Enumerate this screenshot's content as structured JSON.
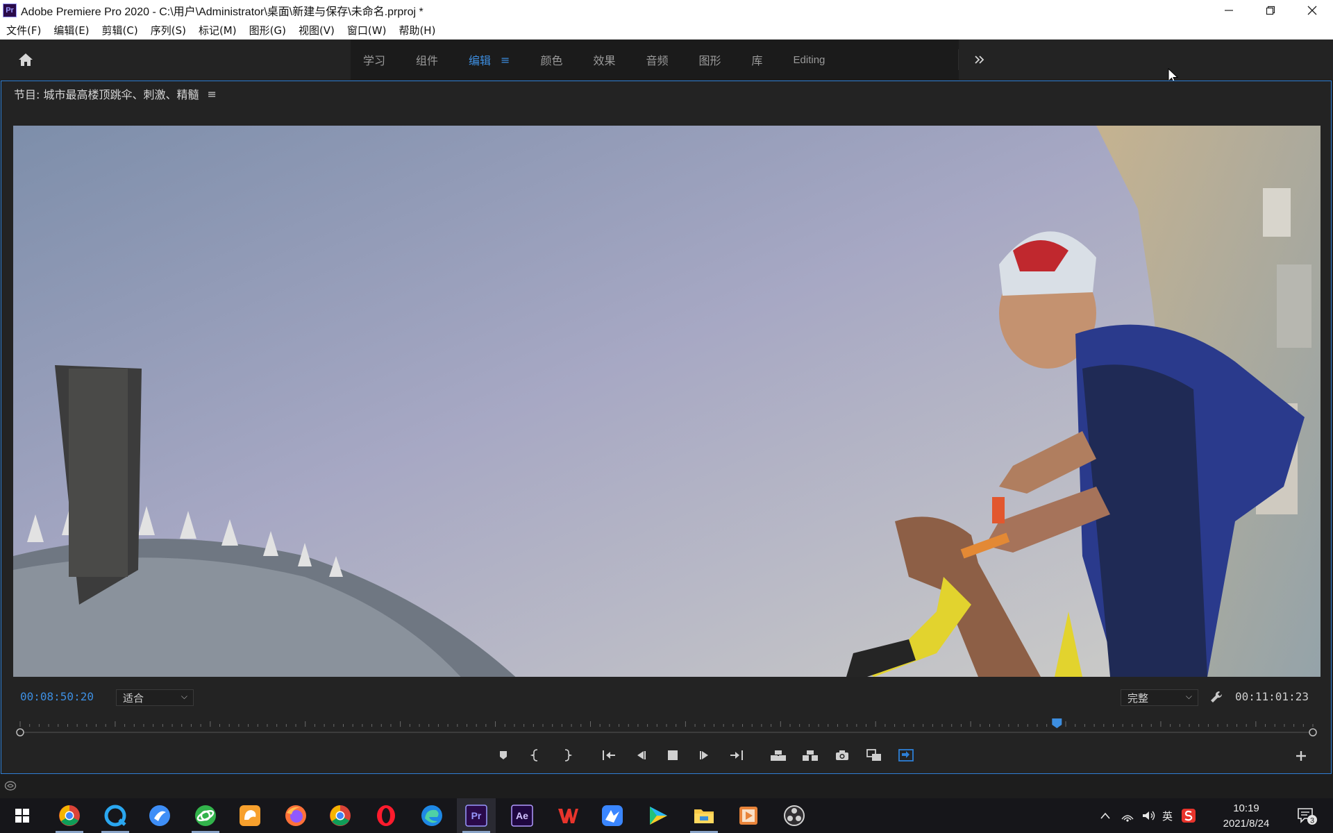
{
  "window": {
    "title": "Adobe Premiere Pro 2020 - C:\\用户\\Administrator\\桌面\\新建与保存\\未命名.prproj *",
    "app_icon": "Pr",
    "controls": [
      "minimize-icon",
      "restore-icon",
      "close-icon"
    ]
  },
  "menu": {
    "items": [
      "文件(F)",
      "编辑(E)",
      "剪辑(C)",
      "序列(S)",
      "标记(M)",
      "图形(G)",
      "视图(V)",
      "窗口(W)",
      "帮助(H)"
    ]
  },
  "workspaces": {
    "tabs": [
      "学习",
      "组件",
      "编辑",
      "颜色",
      "效果",
      "音频",
      "图形",
      "库",
      "Editing"
    ],
    "active": "编辑",
    "more_icon": "double-chevron-right-icon"
  },
  "program_monitor": {
    "title": "节目: 城市最高楼顶跳伞、刺激、精髓",
    "current_timecode": "00:08:50:20",
    "zoom_select": "适合",
    "quality_select": "完整",
    "duration_timecode": "00:11:01:23",
    "playhead_fraction": 0.802,
    "accent_color": "#3d8ee0"
  },
  "transport": {
    "buttons": [
      "add-marker-icon",
      "mark-in-icon",
      "mark-out-icon",
      "go-to-in-icon",
      "step-back-icon",
      "stop-icon",
      "step-forward-icon",
      "go-to-out-icon",
      "lift-icon",
      "extract-icon",
      "export-frame-icon",
      "comparison-view-icon",
      "safe-margins-icon"
    ]
  },
  "taskbar": {
    "apps": [
      "start-icon",
      "chrome-icon",
      "qq-browser-icon",
      "sogou-explorer-icon",
      "360-browser-icon",
      "uc-browser-icon",
      "firefox-icon",
      "chrome-icon",
      "opera-icon",
      "edge-icon",
      "premiere-icon",
      "after-effects-icon",
      "wps-icon",
      "feishu-icon",
      "video-player-icon",
      "file-explorer-icon",
      "media-player-icon",
      "obs-icon"
    ],
    "premiere_label": "Pr",
    "ae_label": "Ae",
    "ime": "英",
    "time": "10:19",
    "date": "2021/8/24",
    "notifications": "3"
  }
}
